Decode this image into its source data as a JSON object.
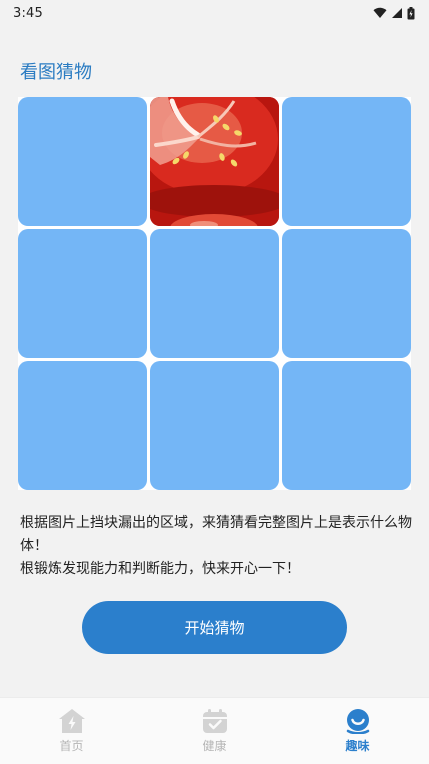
{
  "status_bar": {
    "time": "3:45"
  },
  "page": {
    "title": "看图猜物"
  },
  "puzzle": {
    "tiles": [
      "hidden",
      "revealed",
      "hidden",
      "hidden",
      "hidden",
      "hidden",
      "hidden",
      "hidden",
      "hidden"
    ],
    "revealed_image": "tomato-slice"
  },
  "description": {
    "line1": "根据图片上挡块漏出的区域，来猜猜看完整图片上是表示什么物体！",
    "line2": "根锻炼发现能力和判断能力，快来开心一下！"
  },
  "start_button": {
    "label": "开始猜物"
  },
  "tabbar": {
    "items": [
      {
        "label": "首页",
        "icon": "home-icon",
        "active": false
      },
      {
        "label": "健康",
        "icon": "calendar-check-icon",
        "active": false
      },
      {
        "label": "趣味",
        "icon": "smiley-icon",
        "active": true
      }
    ]
  },
  "colors": {
    "accent": "#2b7fcc",
    "tile_cover": "#74b6f6",
    "title": "#2b7cc2",
    "inactive_tab": "#b5b5b5"
  }
}
